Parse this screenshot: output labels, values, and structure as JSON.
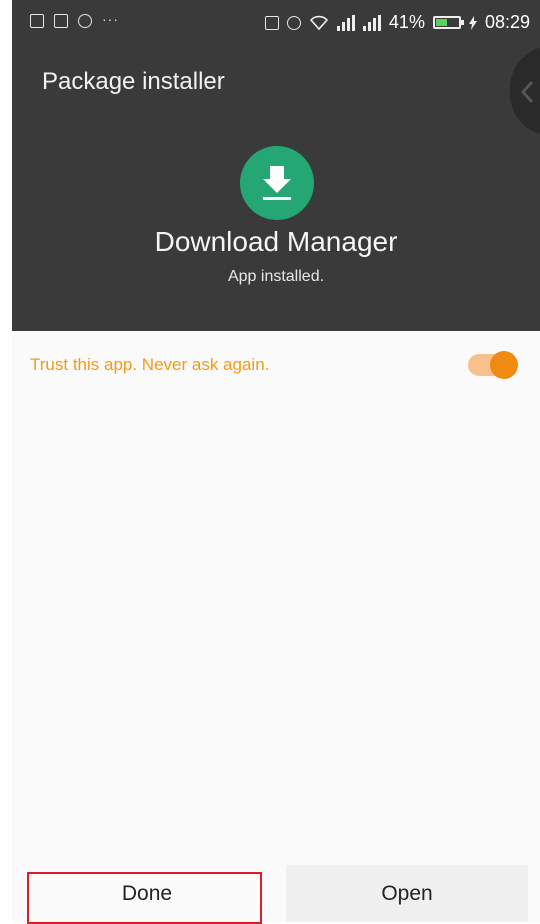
{
  "status_bar": {
    "left_icons": [
      "image-icon",
      "download-icon",
      "target-icon",
      "more-dots-icon"
    ],
    "right_icons": [
      "sim-icon",
      "alarm-icon",
      "wifi-icon",
      "signal-icon",
      "signal-icon"
    ],
    "battery_percent": "41%",
    "time": "08:29"
  },
  "header": {
    "title": "Package installer"
  },
  "app": {
    "name": "Download Manager",
    "status": "App installed."
  },
  "trust": {
    "label": "Trust this app. Never ask again.",
    "enabled": true
  },
  "buttons": {
    "done_label": "Done",
    "open_label": "Open"
  },
  "colors": {
    "header_bg": "#3a3a3a",
    "accent_orange": "#f08a10",
    "app_icon_green": "#25a775",
    "highlight_red": "#d91f26"
  }
}
